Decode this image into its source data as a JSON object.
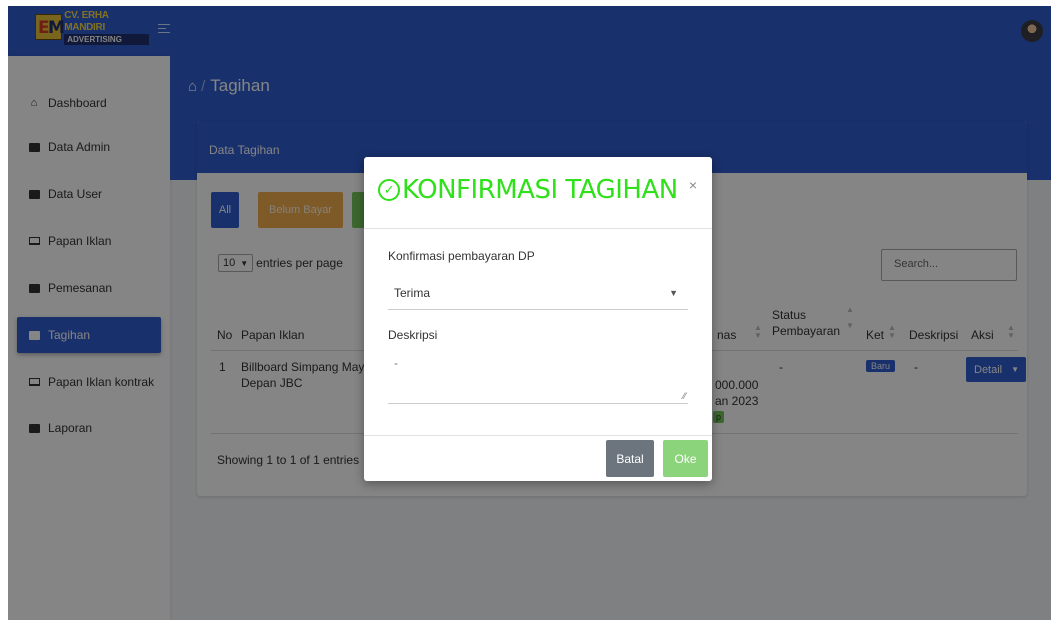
{
  "brand": {
    "logo_letters_1": "E",
    "logo_letters_2": "M",
    "name": "CV. ERHA MANDIRI",
    "tagline": "ADVERTISING"
  },
  "sidebar": {
    "items": [
      {
        "label": "Dashboard",
        "icon": "home-icon"
      },
      {
        "label": "Data Admin",
        "icon": "id-card-icon"
      },
      {
        "label": "Data User",
        "icon": "id-card-icon"
      },
      {
        "label": "Papan Iklan",
        "icon": "monitor-icon"
      },
      {
        "label": "Pemesanan",
        "icon": "list-icon"
      },
      {
        "label": "Tagihan",
        "icon": "card-icon",
        "active": true
      },
      {
        "label": "Papan Iklan kontrak",
        "icon": "screens-icon"
      },
      {
        "label": "Laporan",
        "icon": "printer-icon"
      }
    ]
  },
  "page": {
    "title": "Tagihan",
    "separator": "/"
  },
  "card": {
    "title": "Data Tagihan",
    "filters": {
      "all": "All",
      "belum": "Belum Bayar"
    },
    "entries": {
      "value": "10",
      "suffix": "entries per page"
    },
    "search_placeholder": "Search...",
    "columns": {
      "no": "No",
      "papan": "Papan Iklan",
      "nas": "nas",
      "status_1": "Status",
      "status_2": "Pembayaran",
      "ket": "Ket",
      "deskripsi": "Deskripsi",
      "aksi": "Aksi"
    },
    "row": {
      "no": "1",
      "papan_1": "Billboard Simpang Mayang",
      "papan_2": "Depan JBC",
      "nas_1": "000.000",
      "nas_2": "an 2023",
      "nas_badge": "p",
      "status": "-",
      "ket_badge": "Baru",
      "deskripsi": "-",
      "aksi": "Detail"
    },
    "footer": "Showing 1 to 1 of 1 entries"
  },
  "modal": {
    "title": "KONFIRMASI TAGIHAN",
    "close": "×",
    "field1_label": "Konfirmasi pembayaran DP",
    "field1_value": "Terima",
    "field2_label": "Deskripsi",
    "field2_value": "-",
    "cancel": "Batal",
    "ok": "Oke"
  },
  "colors": {
    "primary": "#2f5ccd",
    "warning": "#f0ad4e",
    "success": "#73c55b",
    "title_green": "#2fe01a",
    "secondary": "#6c757d"
  }
}
